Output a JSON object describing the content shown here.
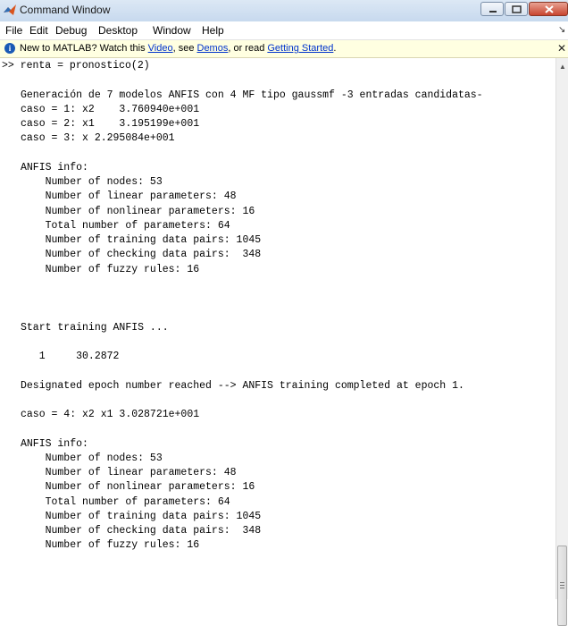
{
  "window": {
    "title": "Command Window",
    "accent": "#c8442f"
  },
  "menu": {
    "file": "File",
    "edit": "Edit",
    "debug": "Debug",
    "desktop": "Desktop",
    "window": "Window",
    "help": "Help"
  },
  "info": {
    "prefix": "New to MATLAB? Watch this ",
    "video": "Video",
    "sep1": ", see ",
    "demos": "Demos",
    "sep2": ", or read ",
    "getting_started": "Getting Started",
    "suffix": "."
  },
  "console": {
    "lines": [
      ">> renta = pronostico(2)",
      "",
      "Generación de 7 modelos ANFIS con 4 MF tipo gaussmf -3 entradas candidatas-",
      "caso = 1: x2    3.760940e+001",
      "caso = 2: x1    3.195199e+001",
      "caso = 3: x 2.295084e+001",
      "",
      "ANFIS info:",
      "    Number of nodes: 53",
      "    Number of linear parameters: 48",
      "    Number of nonlinear parameters: 16",
      "    Total number of parameters: 64",
      "    Number of training data pairs: 1045",
      "    Number of checking data pairs:  348",
      "    Number of fuzzy rules: 16",
      "",
      "",
      "",
      "Start training ANFIS ...",
      "",
      "   1     30.2872",
      "",
      "Designated epoch number reached --> ANFIS training completed at epoch 1.",
      "",
      "caso = 4: x2 x1 3.028721e+001",
      "",
      "ANFIS info:",
      "    Number of nodes: 53",
      "    Number of linear parameters: 48",
      "    Number of nonlinear parameters: 16",
      "    Total number of parameters: 64",
      "    Number of training data pairs: 1045",
      "    Number of checking data pairs:  348",
      "    Number of fuzzy rules: 16"
    ]
  }
}
